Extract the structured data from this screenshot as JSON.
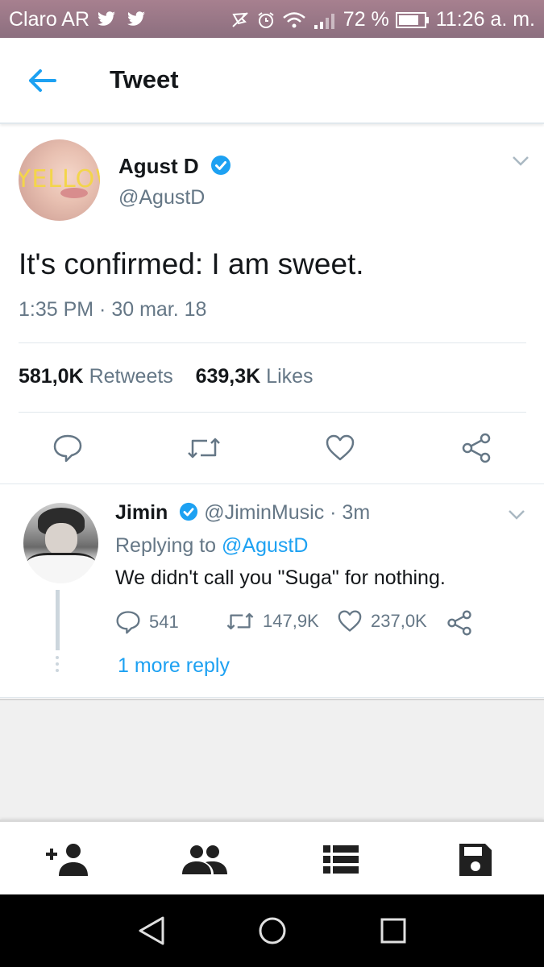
{
  "status_bar": {
    "carrier": "Claro AR",
    "battery_percent": "72 %",
    "time": "11:26 a. m.",
    "icons": [
      "twitter-bird-icon",
      "twitter-bird-icon",
      "mute-icon",
      "alarm-icon",
      "wifi-icon",
      "signal-icon",
      "battery-icon"
    ]
  },
  "app_bar": {
    "title": "Tweet",
    "back_icon": "back-arrow-icon"
  },
  "tweet": {
    "author_name": "Agust D",
    "author_handle": "@AgustD",
    "avatar_text": "YELLOW",
    "verified": true,
    "text": "It's confirmed: I am sweet.",
    "timestamp": "1:35 PM · 30 mar. 18",
    "retweets_count": "581,0K",
    "retweets_label": "Retweets",
    "likes_count": "639,3K",
    "likes_label": "Likes",
    "actions": [
      "reply-icon",
      "retweet-icon",
      "like-icon",
      "share-icon"
    ]
  },
  "reply": {
    "author_name": "Jimin",
    "author_handle": "@JiminMusic",
    "time_ago": "· 3m",
    "replying_prefix": "Replying to",
    "replying_to": "@AgustD",
    "text": "We didn't call you \"Suga\" for nothing.",
    "reply_count": "541",
    "retweet_count": "147,9K",
    "like_count": "237,0K",
    "more_replies": "1 more reply"
  },
  "bottom_nav": {
    "items": [
      "add-user-icon",
      "group-icon",
      "list-icon",
      "save-icon"
    ]
  },
  "system_nav": {
    "items": [
      "back-triangle-icon",
      "home-circle-icon",
      "recents-square-icon"
    ]
  },
  "colors": {
    "accent": "#1da1f2",
    "text_primary": "#14171a",
    "text_secondary": "#657786",
    "status_bar": "#9a7787",
    "nav_icon": "#202020"
  }
}
